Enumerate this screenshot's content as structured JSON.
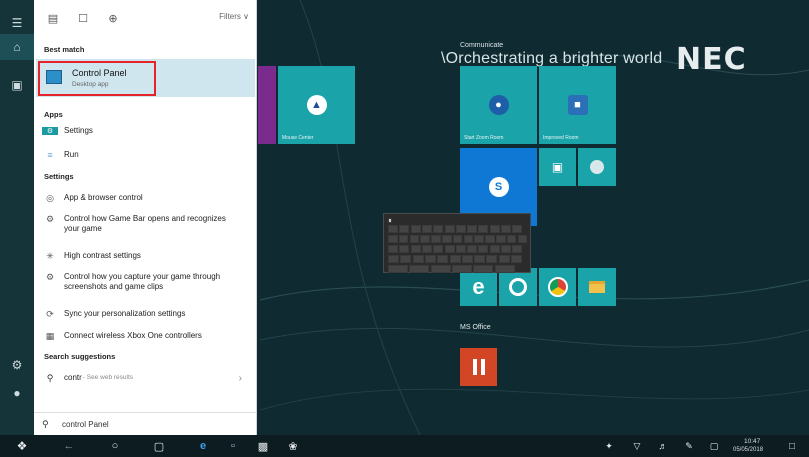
{
  "panel": {
    "filters_label": "Filters ∨",
    "best_match_header": "Best match",
    "best_match": {
      "title": "Control Panel",
      "subtitle": "Desktop app"
    },
    "apps_header": "Apps",
    "apps": [
      {
        "icon": "settings-app-icon",
        "label": "Settings"
      },
      {
        "icon": "run-icon",
        "label": "Run"
      }
    ],
    "settings_header": "Settings",
    "settings": [
      {
        "icon": "shield-icon",
        "label": "App & browser control"
      },
      {
        "icon": "gear-icon",
        "label": "Control how Game Bar opens and recognizes your game"
      },
      {
        "icon": "sun-icon",
        "label": "High contrast settings"
      },
      {
        "icon": "gear-icon",
        "label": "Control how you capture your game through screenshots and game clips"
      },
      {
        "icon": "sync-icon",
        "label": "Sync your personalization settings"
      },
      {
        "icon": "controller-icon",
        "label": "Connect wireless Xbox One controllers"
      }
    ],
    "suggestions_header": "Search suggestions",
    "suggestion": {
      "query": "contr",
      "hint": " - See web results"
    },
    "search_value": "control Panel"
  },
  "desktop": {
    "brand_tagline": "Communicate",
    "brand_line": "\\Orchestrating a brighter world",
    "brand_logo": "NEC",
    "tiles": {
      "mouse_center": "Mouse Center",
      "start_zoom": "Start Zoom Room",
      "improved_room": "Improved Room",
      "ms_office_group": "MS Office"
    }
  },
  "taskbar": {
    "time": "10:47",
    "date": "05/05/2018"
  },
  "colors": {
    "desktop_bg": "#0f2a30",
    "tile": "#1aa3a8",
    "highlight": "#e4232b",
    "selected_item": "#cfe6ee",
    "office_tile": "#d24625"
  }
}
